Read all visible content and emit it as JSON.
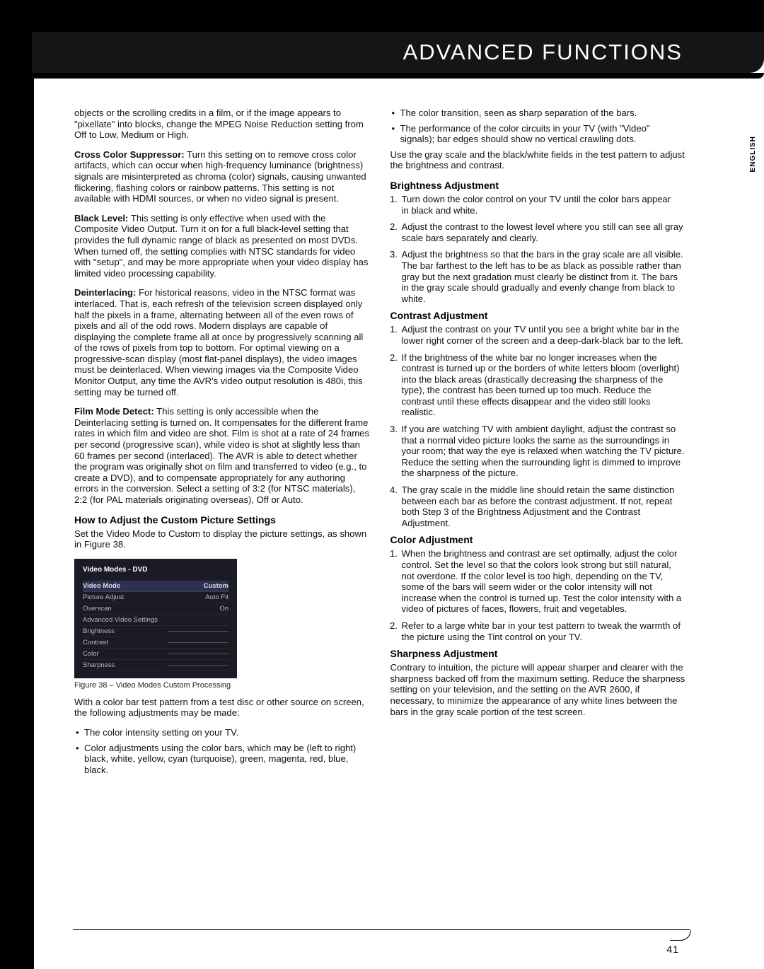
{
  "header": {
    "title": "ADVANCED FUNCTIONS"
  },
  "lang": "ENGLISH",
  "page_number": "41",
  "left": {
    "intro": "objects or the scrolling credits in a film, or if the image appears to \"pixellate\" into blocks, change the MPEG Noise Reduction setting from Off to Low, Medium or High.",
    "ccs_b": "Cross Color Suppressor:",
    "ccs": " Turn this setting on to remove cross color artifacts, which can occur when high-frequency luminance (brightness) signals are misinterpreted as chroma (color) signals, causing unwanted flickering, flashing colors or rainbow patterns. This setting is not available with HDMI sources, or when no video signal is present.",
    "bl_b": "Black Level:",
    "bl": " This setting is only effective when used with the Composite Video Output. Turn it on for a full black-level setting that provides the full dynamic range of black as presented on most DVDs. When turned off, the setting complies with NTSC standards for video with \"setup\", and may be more appropriate when your video display has limited video processing capability.",
    "de_b": "Deinterlacing:",
    "de": " For historical reasons, video in the NTSC format was interlaced. That is, each refresh of the television screen displayed only half the pixels in a frame, alternating between all of the even rows of pixels and all of the odd rows. Modern displays are capable of displaying the complete frame all at once by progressively scanning all of the rows of pixels from top to bottom. For optimal viewing on a progressive-scan display (most flat-panel displays), the video images must be deinterlaced. When viewing images via the Composite Video Monitor Output, any time the AVR's video output resolution is 480i, this setting may be turned off.",
    "fm_b": "Film Mode Detect:",
    "fm": " This setting is only accessible when the Deinterlacing setting is turned on. It compensates for the different frame rates in which film and video are shot. Film is shot at a rate of 24 frames per second (progressive scan), while video is shot at slightly less than 60 frames per second (interlaced). The AVR is able to detect whether the program was originally shot on film and transferred to video (e.g., to create a DVD), and to compensate appropriately for any authoring errors in the conversion. Select a setting of 3:2 (for NTSC materials), 2:2 (for PAL materials originating overseas), Off or Auto.",
    "howto_h": "How to Adjust the Custom Picture Settings",
    "howto_p": "Set the Video Mode to Custom to display the picture settings, as shown in Figure 38.",
    "fig_caption": "Figure 38 – Video Modes Custom Processing",
    "after_fig": "With a color bar test pattern from a test disc or other source on screen, the following adjustments may be made:",
    "bul1": "The color intensity setting on your TV.",
    "bul2": "Color adjustments using the color bars, which may be (left to right) black, white, yellow, cyan (turquoise), green, magenta, red, blue, black."
  },
  "figure": {
    "title": "Video Modes - DVD",
    "rows": [
      {
        "k": "Video Mode",
        "v": "Custom",
        "hi": true
      },
      {
        "k": "Picture Adjust",
        "v": "Auto Fit"
      },
      {
        "k": "Overscan",
        "v": "On"
      },
      {
        "k": "Advanced Video Settings",
        "v": ""
      },
      {
        "k": "Brightness",
        "v": "",
        "slider": true
      },
      {
        "k": "Contrast",
        "v": "",
        "slider": true
      },
      {
        "k": "Color",
        "v": "",
        "slider": true
      },
      {
        "k": "Sharpness",
        "v": "",
        "slider": true
      }
    ]
  },
  "right": {
    "bul_a": "The color transition, seen as sharp separation of the bars.",
    "bul_b": "The performance of the color circuits in your TV (with \"Video\" signals); bar edges should show no vertical crawling dots.",
    "gray": "Use the gray scale and the black/white fields in the test pattern to adjust the brightness and contrast.",
    "bright_h": "Brightness Adjustment",
    "bright1": "Turn down the color control on your TV until the color bars appear\nin black and white.",
    "bright2": "Adjust the contrast to the lowest level where you still can see all gray scale bars separately and clearly.",
    "bright3": "Adjust the brightness so that the bars in the gray scale are all visible. The bar farthest to the left has to be as black as possible rather than gray but the next gradation must clearly be distinct from it. The bars in the gray scale should gradually and evenly change from black to white.",
    "contrast_h": "Contrast Adjustment",
    "contrast1": "Adjust the contrast on your TV until you see a bright white bar in the lower right corner of the screen and a deep-dark-black bar to the left.",
    "contrast2": "If the brightness of the white bar no longer increases when the contrast is turned up or the borders of white letters bloom (overlight) into the black areas (drastically decreasing the sharpness of the type), the contrast has been turned up too much. Reduce the contrast until these effects disappear and the video still looks realistic.",
    "contrast3": "If you are watching TV with ambient daylight, adjust the contrast so that a normal video picture looks the same as the surroundings in your room; that way the eye is relaxed when watching the TV picture. Reduce the setting when the surrounding light is dimmed to improve the sharpness of the picture.",
    "contrast4": "The gray scale in the middle line should retain the same distinction between each bar as before the contrast adjustment. If not, repeat both Step 3 of the Brightness Adjustment and the Contrast Adjustment.",
    "color_h": "Color Adjustment",
    "color1": "When the brightness and contrast are set optimally, adjust the color control. Set the level so that the colors look strong but still natural, not overdone. If the color level is too high, depending on the TV, some of the bars will seem wider or the color intensity will not increase when the control is turned up. Test the color intensity with a video of pictures of faces, flowers, fruit and vegetables.",
    "color2": "Refer to a large white bar in your test pattern to tweak the warmth of the picture using the Tint control on your TV.",
    "sharp_h": "Sharpness Adjustment",
    "sharp_p": "Contrary to intuition, the picture will appear sharper and clearer with the sharpness backed off from the maximum setting. Reduce the sharpness setting on your television, and the setting on the AVR 2600, if necessary, to minimize the appearance of any white lines between the bars in the gray scale portion of the test screen."
  }
}
